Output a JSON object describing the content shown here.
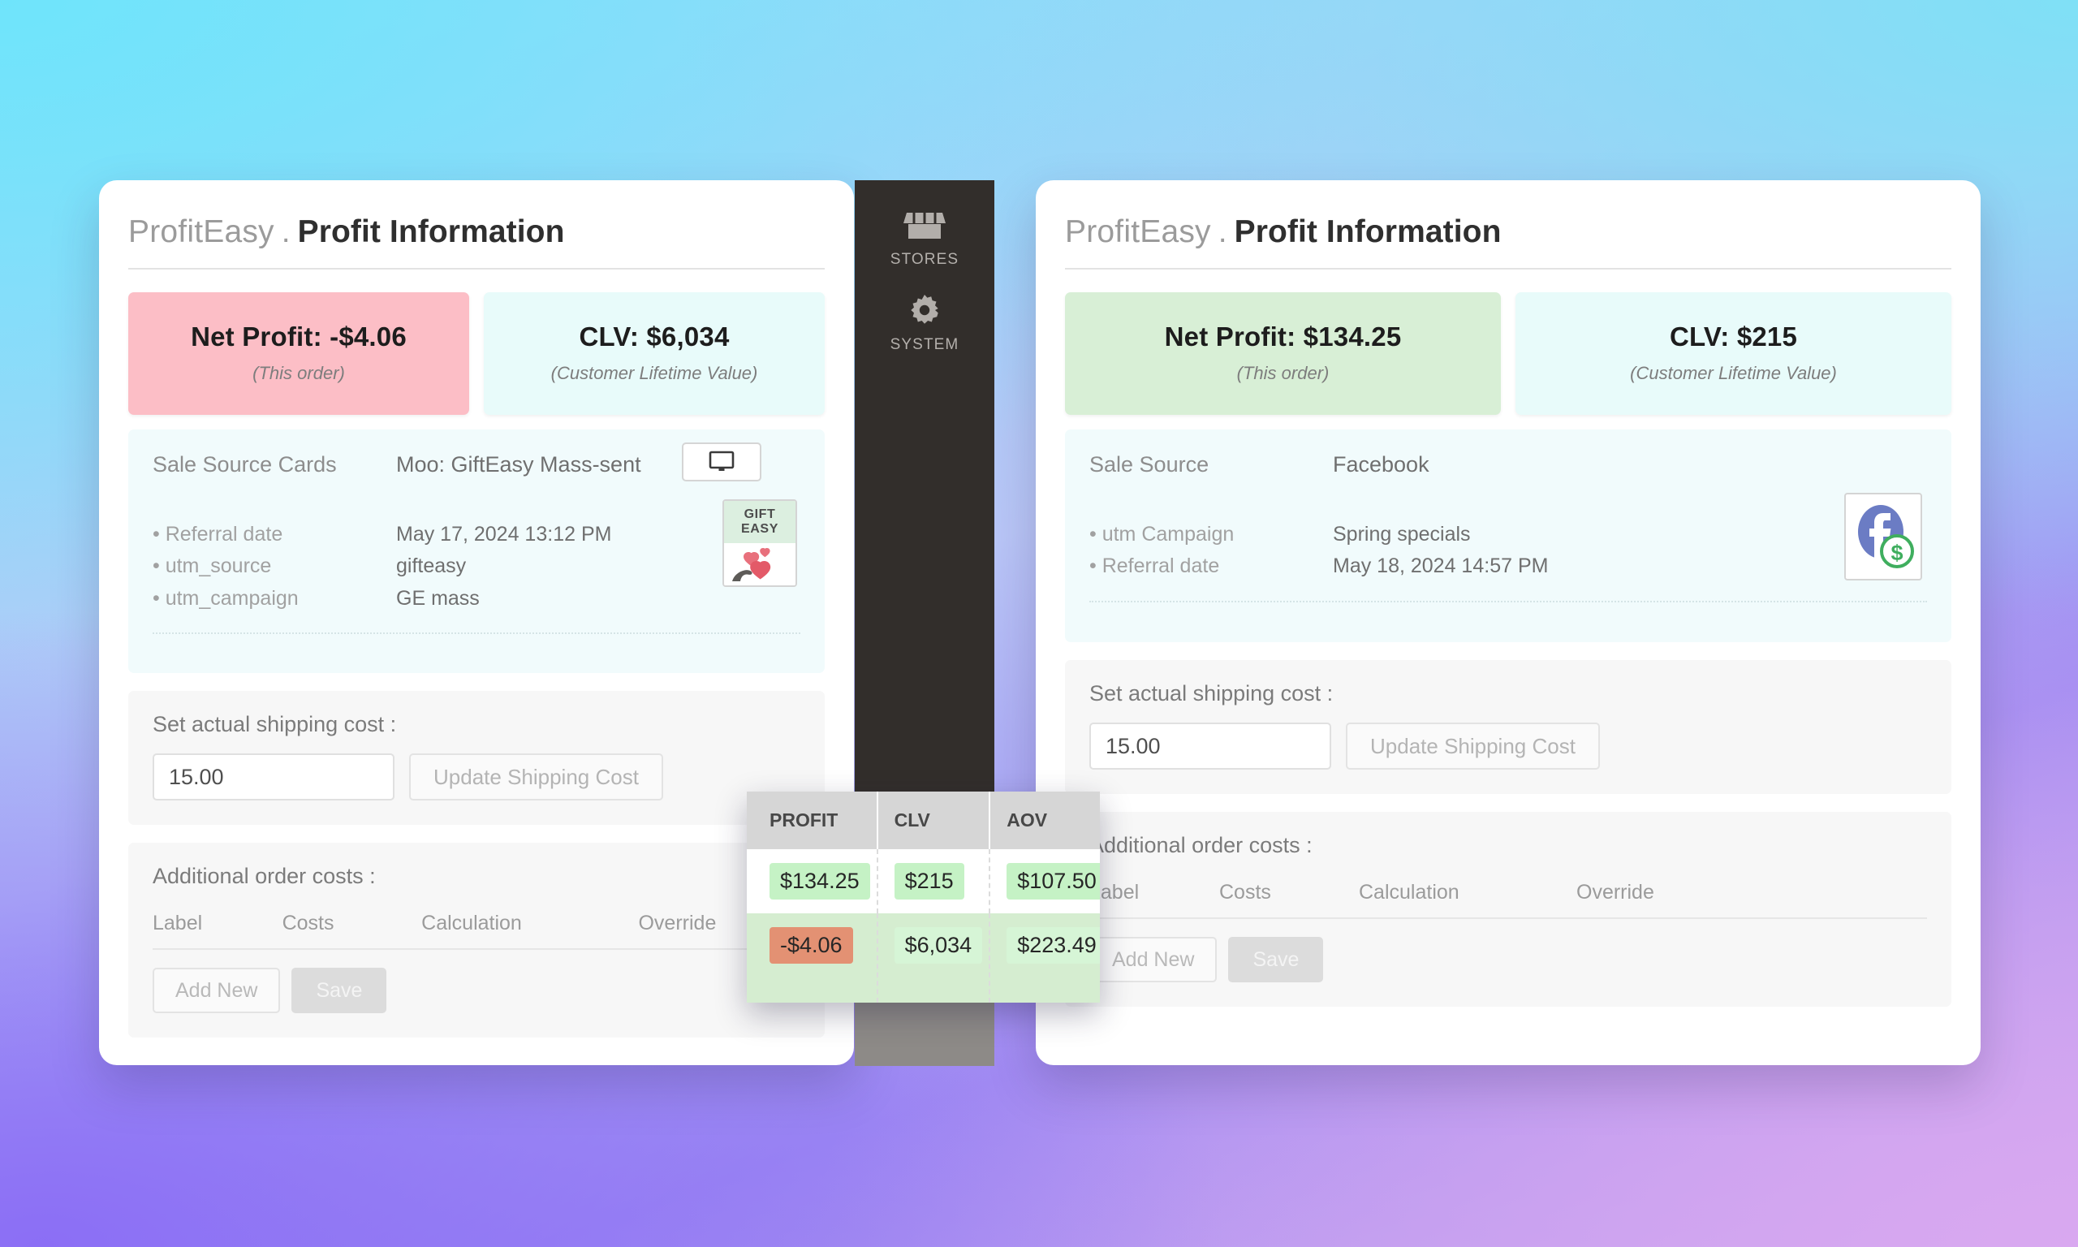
{
  "brand": "ProfitEasy",
  "separator": ".",
  "page_title": "Profit Information",
  "sidebar": {
    "items": [
      {
        "label": "STORES",
        "icon": "storefront-icon"
      },
      {
        "label": "SYSTEM",
        "icon": "gear-icon"
      }
    ]
  },
  "left_panel": {
    "kpis": [
      {
        "value": "Net Profit: -$4.06",
        "sub": "(This order)",
        "tone": "negative"
      },
      {
        "value": "CLV: $6,034",
        "sub": "(Customer Lifetime Value)",
        "tone": "info"
      }
    ],
    "source": {
      "label": "Sale Source Cards",
      "value": "Moo: GiftEasy Mass-sent",
      "device_icon": "desktop-monitor-icon",
      "logo": {
        "icon": "gift-easy-card-icon",
        "line1": "GIFT",
        "line2": "EASY"
      },
      "rows": [
        {
          "key": "• Referral date",
          "value": "May 17, 2024 13:12 PM"
        },
        {
          "key": "• utm_source",
          "value": "gifteasy"
        },
        {
          "key": "• utm_campaign",
          "value": "GE mass"
        }
      ]
    },
    "shipping": {
      "label": "Set actual shipping cost :",
      "value": "15.00",
      "placeholder": "0.00",
      "button": "Update Shipping Cost"
    },
    "costs": {
      "label": "Additional order costs :",
      "columns": [
        "Label",
        "Costs",
        "Calculation",
        "Override"
      ],
      "add_button": "Add New",
      "save_button": "Save"
    }
  },
  "right_panel": {
    "kpis": [
      {
        "value": "Net Profit: $134.25",
        "sub": "(This order)",
        "tone": "positive"
      },
      {
        "value": "CLV: $215",
        "sub": "(Customer Lifetime Value)",
        "tone": "info"
      }
    ],
    "source": {
      "label": "Sale Source",
      "value": "Facebook",
      "logo": {
        "icon": "facebook-dollar-icon"
      },
      "rows": [
        {
          "key": "• utm Campaign",
          "value": "Spring specials"
        },
        {
          "key": "• Referral date",
          "value": "May 18, 2024 14:57 PM"
        }
      ]
    },
    "shipping": {
      "label": "Set actual shipping cost :",
      "value": "15.00",
      "placeholder": "0.00",
      "button": "Update Shipping Cost"
    },
    "costs": {
      "label": "Additional order costs :",
      "columns": [
        "Label",
        "Costs",
        "Calculation",
        "Override"
      ],
      "add_button": "Add New",
      "save_button": "Save"
    }
  },
  "metrics_table": {
    "columns": [
      "PROFIT",
      "CLV",
      "AOV"
    ],
    "rows": [
      {
        "profit": "$134.25",
        "profit_tone": "green",
        "clv": "$215",
        "aov": "$107.50"
      },
      {
        "profit": "-$4.06",
        "profit_tone": "red",
        "clv": "$6,034",
        "aov": "$223.49"
      }
    ]
  },
  "colors": {
    "negative_card": "#fcbec6",
    "positive_card": "#d8efd6",
    "info_card": "#e8fbfa",
    "chip_green": "#c5f2c5",
    "chip_red": "#e39173",
    "sidebar_dark": "#322e2b",
    "sidebar_grey": "#8d8a87"
  }
}
